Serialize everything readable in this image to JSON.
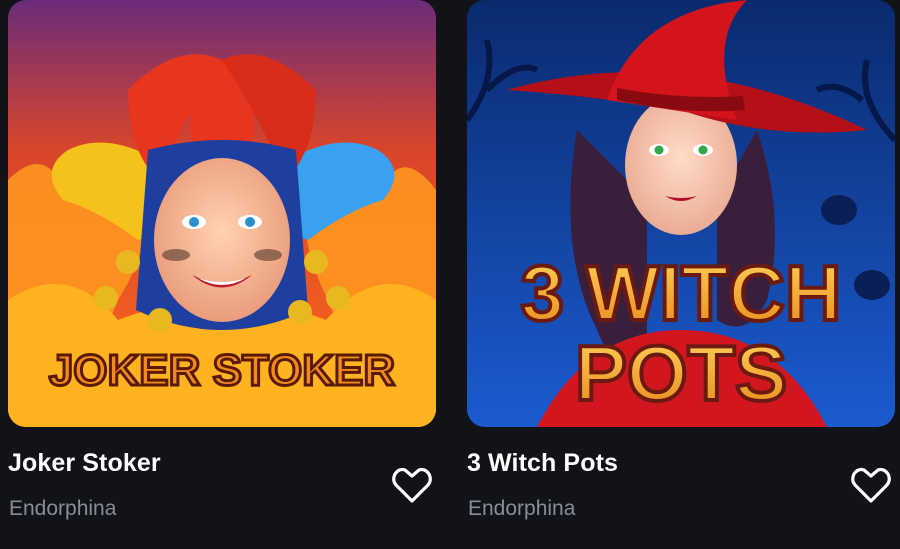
{
  "games": [
    {
      "title": "Joker Stoker",
      "provider": "Endorphina",
      "art_text": "JOKER STOKER",
      "colors": {
        "bg_top": "#6b2c7a",
        "bg_bottom": "#ff6a1a",
        "flame": "#ffb21f",
        "hat_left": "#f5c21b",
        "hat_center": "#e8351e",
        "hat_right": "#3aa0f0"
      }
    },
    {
      "title": "3 Witch Pots",
      "provider": "Endorphina",
      "art_text_line1": "3 WITCH",
      "art_text_line2": "POTS",
      "colors": {
        "bg_top": "#0a2a6e",
        "bg_bottom": "#1b5bd0",
        "hat": "#d4141c",
        "hair": "#3a1f3d",
        "text": "#f7b21e"
      }
    }
  ],
  "favorite_icon": "heart-outline-icon"
}
